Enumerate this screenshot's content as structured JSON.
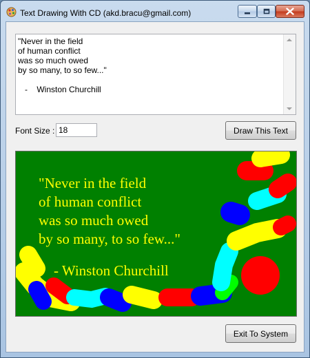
{
  "window": {
    "title": "Text Drawing With CD (akd.bracu@gmail.com)"
  },
  "quote": {
    "text": "\"Never in the field\nof human conflict\nwas so much owed\nby so many, to so few...\"\n\n   -    Winston Churchill"
  },
  "controls": {
    "font_size_label": "Font Size :",
    "font_size_value": "18",
    "draw_button": "Draw This Text",
    "exit_button": "Exit To System"
  },
  "canvas": {
    "background": "#008000",
    "text_color": "#ffff00",
    "font_size": 18,
    "lines": [
      "\"Never in the field",
      "of human conflict",
      "was so much owed",
      "by so many, to so few...\"",
      "",
      "-    Winston Churchill"
    ],
    "stroke_colors": [
      "#ffff00",
      "#ff0000",
      "#00ffff",
      "#0000ff"
    ]
  }
}
